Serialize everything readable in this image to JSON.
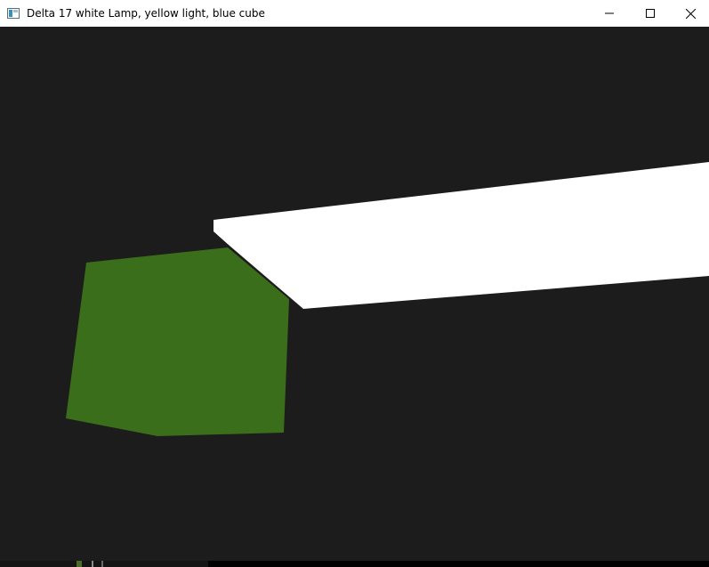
{
  "window": {
    "title": "Delta 17 white Lamp, yellow light, blue cube"
  },
  "caption_buttons": {
    "minimize_icon": "minimize-icon",
    "maximize_icon": "maximize-icon",
    "close_icon": "close-icon"
  },
  "scene": {
    "background_color": "#1c1c1c",
    "lamp_color": "#ffffff",
    "cube_color": "#3b6e1a"
  }
}
